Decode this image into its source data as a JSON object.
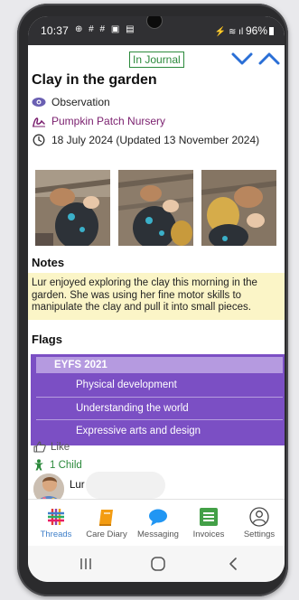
{
  "status_bar": {
    "time": "10:37",
    "battery": "96%"
  },
  "header": {
    "journal_tag": "In Journal"
  },
  "entry": {
    "title": "Clay in the garden",
    "type": "Observation",
    "location": "Pumpkin Patch Nursery",
    "date": "18 July 2024 (Updated 13 November 2024)"
  },
  "notes": {
    "heading": "Notes",
    "text": "Lur enjoyed exploring the clay this morning in the garden. She was using her fine motor skills to manipulate the clay and pull it into small pieces."
  },
  "flags": {
    "heading": "Flags",
    "framework": "EYFS 2021",
    "items": [
      "Physical development",
      "Understanding the world",
      "Expressive arts and design"
    ]
  },
  "social": {
    "like_label": "Like",
    "child_count": "1 Child",
    "child_name": "Lur"
  },
  "tabs": [
    {
      "label": "Threads",
      "icon": "threads-icon"
    },
    {
      "label": "Care Diary",
      "icon": "care-diary-icon"
    },
    {
      "label": "Messaging",
      "icon": "messaging-icon"
    },
    {
      "label": "Invoices",
      "icon": "invoices-icon"
    },
    {
      "label": "Settings",
      "icon": "settings-icon"
    }
  ],
  "colors": {
    "accent": "#2c8a3c",
    "flags_purple": "#7b4fc4",
    "notes_bg": "#fbf5c7",
    "active_tab": "#3f7fc9",
    "chevron_blue": "#2a6fd6"
  }
}
